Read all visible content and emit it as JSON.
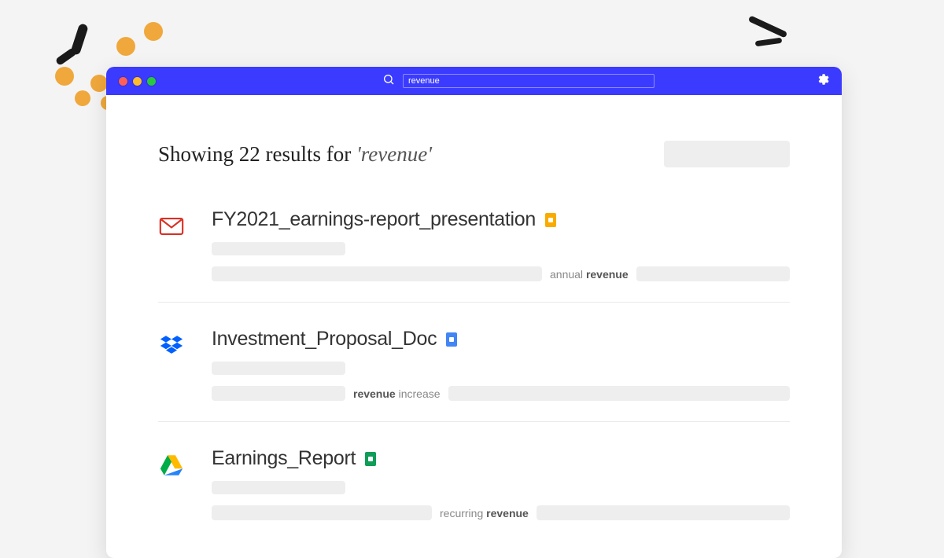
{
  "search": {
    "value": "revenue"
  },
  "results_header": {
    "prefix": "Showing ",
    "count": "22",
    "middle": " results for ",
    "query": "'revenue'"
  },
  "results": [
    {
      "title": "FY2021_earnings-report_presentation",
      "snippet_before": "annual ",
      "snippet_match": "revenue"
    },
    {
      "title": "Investment_Proposal_Doc",
      "snippet_match": "revenue",
      "snippet_after": " increase"
    },
    {
      "title": "Earnings_Report",
      "snippet_before": "recurring ",
      "snippet_match": "revenue"
    }
  ]
}
